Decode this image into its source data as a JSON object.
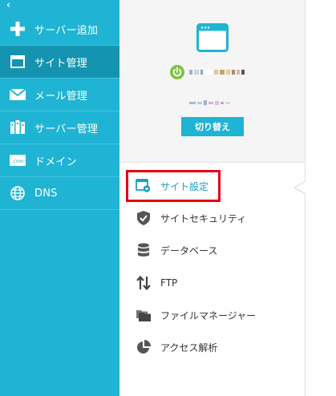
{
  "sidebar": {
    "back_glyph": "‹",
    "items": [
      {
        "label": "サーバー追加",
        "icon": "plus-icon"
      },
      {
        "label": "サイト管理",
        "icon": "site-window-icon",
        "active": true
      },
      {
        "label": "メール管理",
        "icon": "envelope-icon"
      },
      {
        "label": "サーバー管理",
        "icon": "server-icon"
      },
      {
        "label": "ドメイン",
        "icon": "domain-com-icon"
      },
      {
        "label": "DNS",
        "icon": "globe-icon"
      }
    ]
  },
  "server": {
    "status": "running",
    "switch_label": "切り替え"
  },
  "menu": {
    "items": [
      {
        "label": "サイト設定",
        "icon": "site-settings-icon",
        "active": true
      },
      {
        "label": "サイトセキュリティ",
        "icon": "shield-check-icon"
      },
      {
        "label": "データベース",
        "icon": "database-icon"
      },
      {
        "label": "FTP",
        "icon": "transfer-arrows-icon"
      },
      {
        "label": "ファイルマネージャー",
        "icon": "folders-icon"
      },
      {
        "label": "アクセス解析",
        "icon": "pie-chart-icon"
      }
    ]
  },
  "colors": {
    "sidebar_bg": "#1fb4d3",
    "sidebar_active": "#1494b1",
    "accent": "#1fb4d3",
    "highlight": "#e60012",
    "power_green": "#7cc242"
  }
}
